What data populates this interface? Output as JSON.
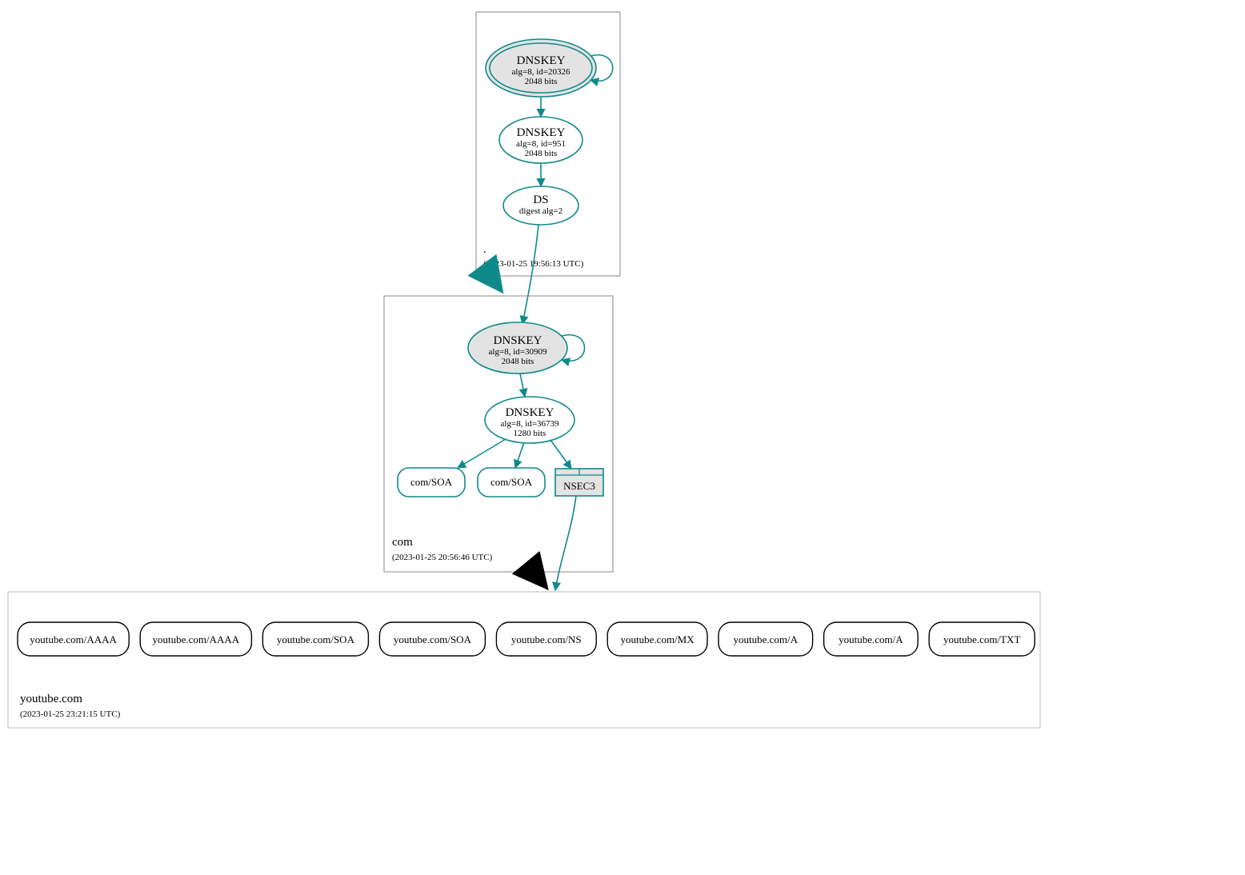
{
  "zones": {
    "root": {
      "title": ".",
      "timestamp": "(2023-01-25 19:56:13 UTC)"
    },
    "com": {
      "title": "com",
      "timestamp": "(2023-01-25 20:56:46 UTC)"
    },
    "youtube": {
      "title": "youtube.com",
      "timestamp": "(2023-01-25 23:21:15 UTC)"
    }
  },
  "nodes": {
    "root_ksk": {
      "line1": "DNSKEY",
      "line2": "alg=8, id=20326",
      "line3": "2048 bits"
    },
    "root_zsk": {
      "line1": "DNSKEY",
      "line2": "alg=8, id=951",
      "line3": "2048 bits"
    },
    "root_ds": {
      "line1": "DS",
      "line2": "digest alg=2"
    },
    "com_ksk": {
      "line1": "DNSKEY",
      "line2": "alg=8, id=30909",
      "line3": "2048 bits"
    },
    "com_zsk": {
      "line1": "DNSKEY",
      "line2": "alg=8, id=36739",
      "line3": "1280 bits"
    },
    "com_soa1": {
      "label": "com/SOA"
    },
    "com_soa2": {
      "label": "com/SOA"
    },
    "com_nsec3": {
      "label": "NSEC3"
    }
  },
  "rrsets": [
    "youtube.com/AAAA",
    "youtube.com/AAAA",
    "youtube.com/SOA",
    "youtube.com/SOA",
    "youtube.com/NS",
    "youtube.com/MX",
    "youtube.com/A",
    "youtube.com/A",
    "youtube.com/TXT"
  ]
}
